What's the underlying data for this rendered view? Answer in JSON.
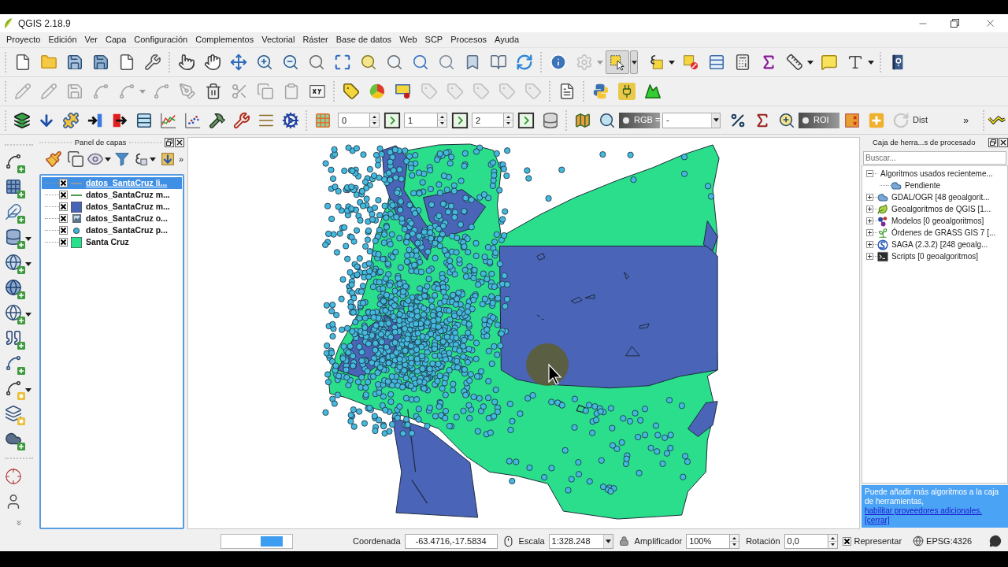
{
  "window": {
    "title": "QGIS 2.18.9"
  },
  "menu": [
    "Proyecto",
    "Edición",
    "Ver",
    "Capa",
    "Configuración",
    "Complementos",
    "Vectorial",
    "Ráster",
    "Base de datos",
    "Web",
    "SCP",
    "Procesos",
    "Ayuda"
  ],
  "toolbars": {
    "selection_tool": {
      "pressed": true
    },
    "actions_tool": {
      "disabled": true
    },
    "digitizing": {
      "disabled": true
    },
    "label_tools": {
      "disabled": true
    },
    "rotate_tool": {
      "disabled": true
    },
    "raster_spinboxes": [
      "0",
      "1",
      "2"
    ],
    "rgb_toggle": {
      "label": "RGB =",
      "on": false
    },
    "band_combo": {
      "value": "-"
    },
    "roi_toggle": {
      "label": "ROI",
      "on": false
    },
    "dist_label": "Dist",
    "overflow": "»"
  },
  "layers_panel": {
    "title": "Panel de capas",
    "overflow": "»",
    "layers": [
      {
        "name": "datos_SantaCruz li...",
        "checked": true,
        "selected": true,
        "kind": "line",
        "color": "#8f9aa8"
      },
      {
        "name": "datos_SantaCruz m...",
        "checked": true,
        "selected": false,
        "kind": "line",
        "color": "#4c9a4c"
      },
      {
        "name": "datos_SantaCruz m...",
        "checked": true,
        "selected": false,
        "kind": "fill",
        "color": "#4864b7"
      },
      {
        "name": "datos_SantaCruz o...",
        "checked": true,
        "selected": false,
        "kind": "raster"
      },
      {
        "name": "datos_SantaCruz p...",
        "checked": true,
        "selected": false,
        "kind": "point",
        "color": "#3fb4d6"
      },
      {
        "name": "Santa Cruz",
        "checked": true,
        "selected": false,
        "kind": "fill",
        "color": "#29df8c"
      }
    ]
  },
  "processing_panel": {
    "title": "Caja de herra...s de procesado",
    "search": {
      "placeholder": "Buscar..."
    },
    "tree": [
      {
        "label": "Algoritmos usados recienteme...",
        "kind": "recent",
        "expanded": true,
        "children": [
          {
            "label": "Pendiente",
            "kind": "algorithm"
          }
        ]
      },
      {
        "label": "GDAL/OGR [48 geoalgorit...",
        "kind": "gdal",
        "expanded": false
      },
      {
        "label": "Geoalgoritmos de QGIS [1...",
        "kind": "qgis",
        "expanded": false
      },
      {
        "label": "Modelos [0 geoalgoritmos]",
        "kind": "models",
        "expanded": false
      },
      {
        "label": "Órdenes de GRASS GIS 7 [...",
        "kind": "grass",
        "expanded": false
      },
      {
        "label": "SAGA (2.3.2) [248 geoalg...",
        "kind": "saga",
        "expanded": false
      },
      {
        "label": "Scripts [0 geoalgoritmos]",
        "kind": "scripts",
        "expanded": false
      }
    ],
    "notice": {
      "text": "Puede añadir más algoritmos a la caja de herramientas,",
      "link": "habilitar proveedores adicionales.",
      "close": "[cerrar]"
    }
  },
  "status_bar": {
    "coordinate_label": "Coordenada",
    "coordinate": "-63.4716,-17.5834",
    "scale_label": "Escala",
    "scale": "1:328.248",
    "magnifier_label": "Amplificador",
    "magnifier": "100%",
    "rotation_label": "Rotación",
    "rotation": "0,0",
    "render": {
      "label": "Representar",
      "checked": true
    },
    "crs": "EPSG:4326"
  }
}
